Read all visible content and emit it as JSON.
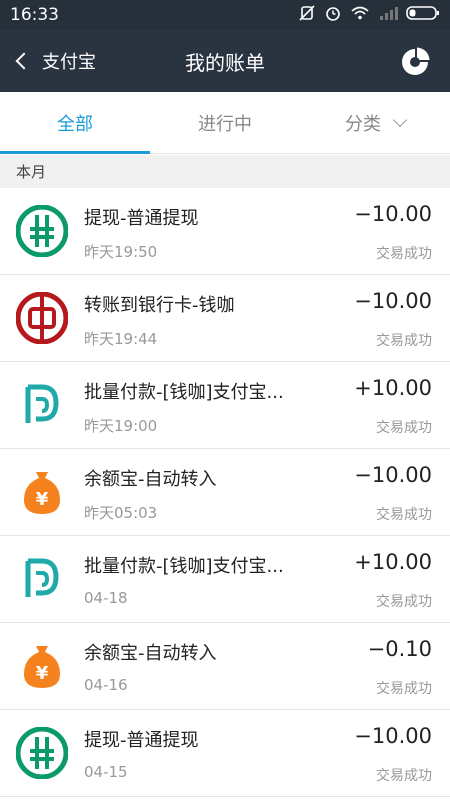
{
  "status_bar": {
    "time": "16:33"
  },
  "nav": {
    "back_label": "支付宝",
    "title": "我的账单"
  },
  "tabs": [
    {
      "label": "全部",
      "active": true
    },
    {
      "label": "进行中",
      "active": false
    },
    {
      "label": "分类",
      "active": false
    }
  ],
  "section": {
    "label": "本月"
  },
  "bills": [
    {
      "icon": "abc-bank-icon",
      "title": "提现-普通提现",
      "date": "昨天19:50",
      "amount": "−10.00",
      "status": "交易成功"
    },
    {
      "icon": "boc-bank-icon",
      "title": "转账到银行卡-钱咖",
      "date": "昨天19:44",
      "amount": "−10.00",
      "status": "交易成功"
    },
    {
      "icon": "qianka-icon",
      "title": "批量付款-[钱咖]支付宝...",
      "date": "昨天19:00",
      "amount": "+10.00",
      "status": "交易成功"
    },
    {
      "icon": "yuebao-icon",
      "title": "余额宝-自动转入",
      "date": "昨天05:03",
      "amount": "−10.00",
      "status": "交易成功"
    },
    {
      "icon": "qianka-icon",
      "title": "批量付款-[钱咖]支付宝...",
      "date": "04-18",
      "amount": "+10.00",
      "status": "交易成功"
    },
    {
      "icon": "yuebao-icon",
      "title": "余额宝-自动转入",
      "date": "04-16",
      "amount": "−0.10",
      "status": "交易成功"
    },
    {
      "icon": "abc-bank-icon",
      "title": "提现-普通提现",
      "date": "04-15",
      "amount": "−10.00",
      "status": "交易成功"
    }
  ],
  "colors": {
    "accent": "#1a9ad6",
    "header_bg": "#2a3440",
    "abc_green": "#0a9a6c",
    "boc_red": "#b5191d",
    "qianka_teal": "#1fa9a8",
    "yuebao_orange": "#f5821f"
  }
}
